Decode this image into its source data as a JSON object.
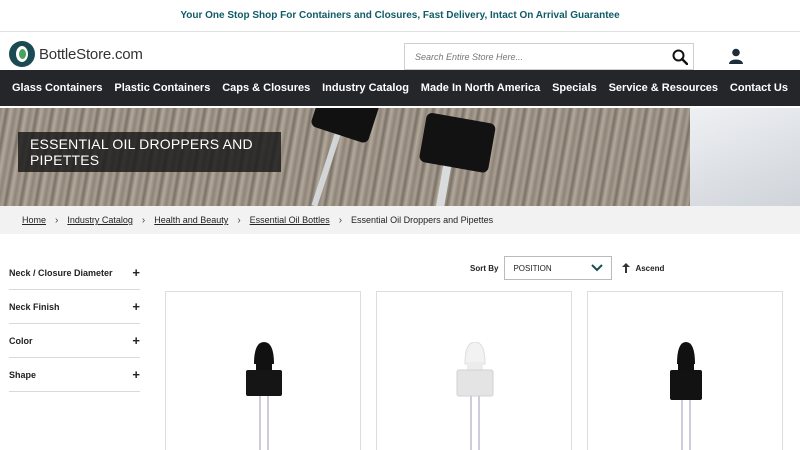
{
  "promo": "Your One Stop Shop For Containers and Closures, Fast Delivery, Intact On Arrival Guarantee",
  "logo": {
    "text": "BottleStore.com"
  },
  "search": {
    "placeholder": "Search Entire Store Here..."
  },
  "nav": [
    "Glass Containers",
    "Plastic Containers",
    "Caps & Closures",
    "Industry Catalog",
    "Made In North America",
    "Specials",
    "Service & Resources",
    "Contact Us"
  ],
  "hero": {
    "title": "ESSENTIAL OIL DROPPERS AND PIPETTES"
  },
  "breadcrumbs": [
    "Home",
    "Industry Catalog",
    "Health and Beauty",
    "Essential Oil Bottles",
    "Essential Oil Droppers and Pipettes"
  ],
  "filters": [
    "Neck / Closure Diameter",
    "Neck Finish",
    "Color",
    "Shape"
  ],
  "sort": {
    "label": "Sort By",
    "value": "POSITION",
    "direction": "Ascend"
  },
  "products": [
    {
      "bulb": "#111111",
      "collar": "#111111",
      "name": "black-dropper-image"
    },
    {
      "bulb": "#f4f4f4",
      "collar": "#e6e6e6",
      "name": "white-dropper-image"
    },
    {
      "bulb": "#111111",
      "collar": "#111111",
      "name": "black-slim-dropper-image"
    }
  ],
  "colors": {
    "nav_bg": "#24262a",
    "promo_text": "#0f5c66",
    "accent": "#1a4b52"
  }
}
